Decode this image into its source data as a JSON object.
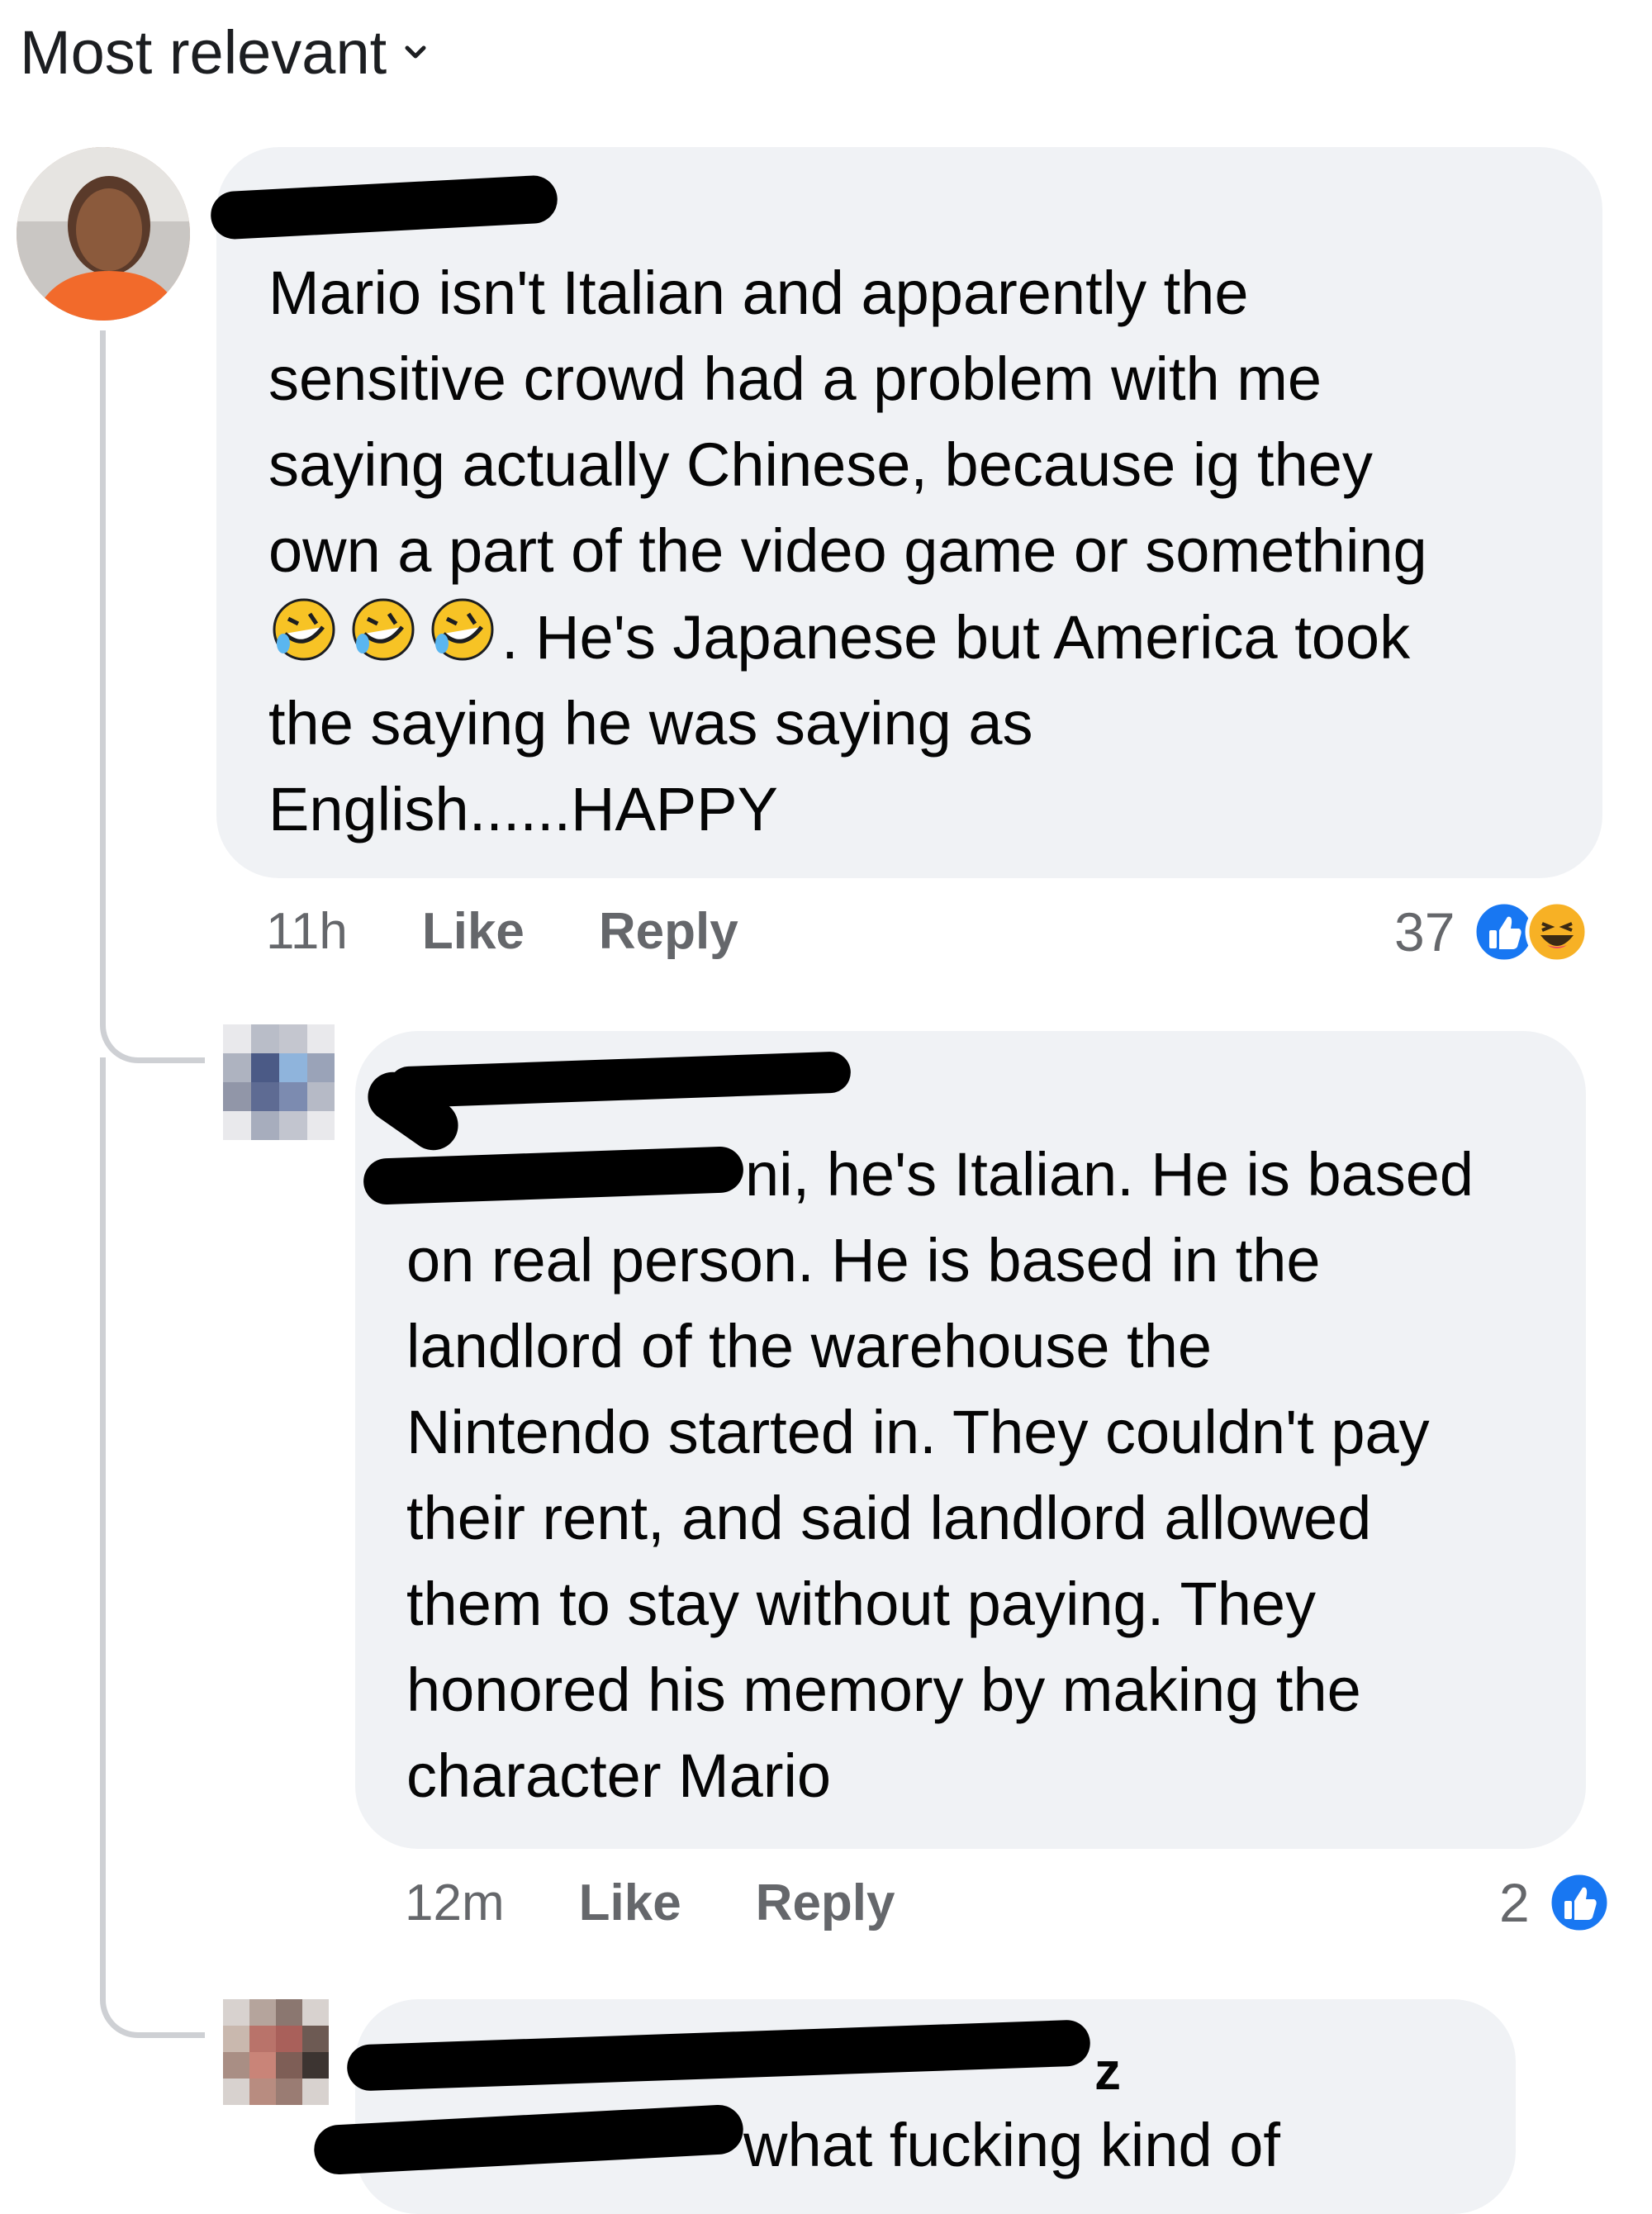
{
  "header": {
    "sort_label": "Most relevant"
  },
  "comments": [
    {
      "text_before_emoji": "Mario isn't Italian and apparently the\nsensitive crowd had a problem with me\nsaying actually Chinese, because ig they\nown a part of the video game or something\n",
      "text_after_emoji": ". He's Japanese  but America took\nthe saying he was saying as\nEnglish......HAPPY",
      "emojis": [
        "rolling-on-floor-laughing",
        "rolling-on-floor-laughing",
        "rolling-on-floor-laughing"
      ],
      "time": "11h",
      "like_label": "Like",
      "reply_label": "Reply",
      "reaction_count": "37",
      "reactions": [
        "like",
        "haha"
      ]
    },
    {
      "text": "ni, he's Italian. He is based\non real person. He is based in the\nlandlord of the warehouse the\nNintendo started in. They couldn't pay\ntheir rent, and said landlord allowed\nthem to stay without paying. They\nhonored his memory by making the\ncharacter Mario",
      "time": "12m",
      "like_label": "Like",
      "reply_label": "Reply",
      "reaction_count": "2",
      "reactions": [
        "like"
      ]
    },
    {
      "name_partial": "z",
      "text": "what fucking kind of"
    }
  ],
  "colors": {
    "bubble": "#f0f2f5",
    "meta_text": "#65676b",
    "like_blue": "#1877f2",
    "haha_yellow": "#f7b125",
    "thread_line": "#ced0d4"
  }
}
